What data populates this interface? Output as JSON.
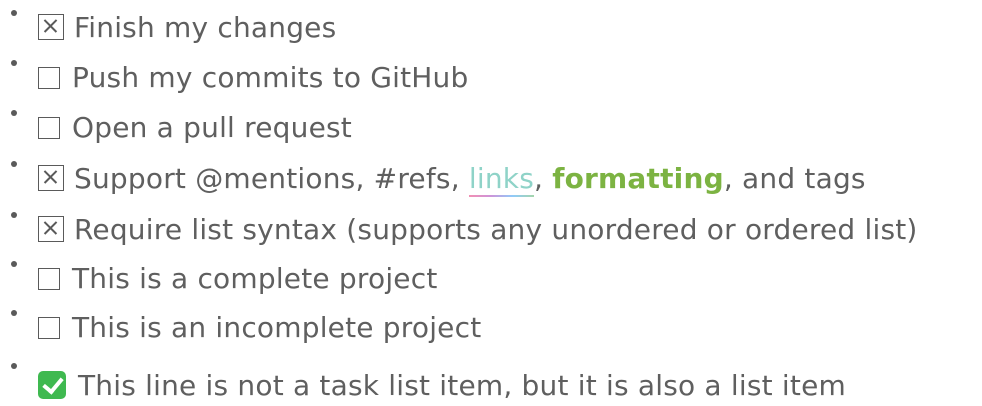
{
  "items": [
    {
      "status": "checked",
      "text": "Finish my changes"
    },
    {
      "status": "unchecked",
      "text": "Push my commits to GitHub"
    },
    {
      "status": "unchecked",
      "text": "Open a pull request"
    },
    {
      "status": "checked",
      "text_before": "Support @mentions, #refs, ",
      "link": "links",
      "text_between": ", ",
      "bold": "formatting",
      "text_after": ", and tags"
    },
    {
      "status": "checked",
      "text": "Require list syntax (supports any unordered or ordered list)"
    },
    {
      "status": "unchecked",
      "text": "This is a complete project"
    },
    {
      "status": "unchecked",
      "text": "This is an incomplete project"
    },
    {
      "status": "emoji-check",
      "text": "This line is not a task list item, but it is also a list item"
    }
  ],
  "colors": {
    "text": "#5f5f5f",
    "link": "#8fd3c8",
    "bold": "#7cb342",
    "emoji_check": "#3fb950"
  },
  "icons": {
    "checked": "checkbox-checked-icon",
    "unchecked": "checkbox-unchecked-icon",
    "emoji": "white-check-mark-emoji-icon"
  }
}
